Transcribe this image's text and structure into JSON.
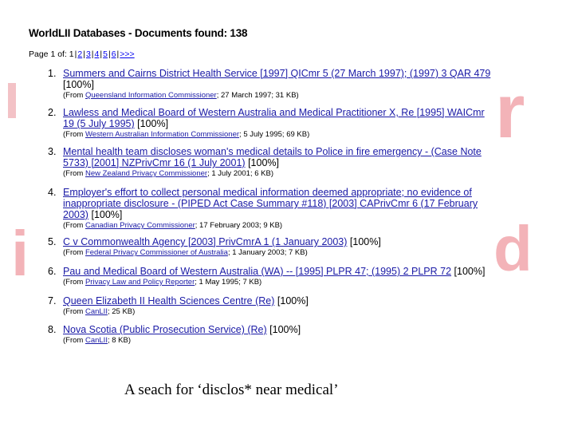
{
  "header": {
    "title": "WorldLII Databases - Documents found: 138"
  },
  "pager": {
    "prefix": "Page 1 of:",
    "current": "1",
    "pages": [
      "2",
      "3",
      "4",
      "5",
      "6"
    ],
    "next": ">>>"
  },
  "results": [
    {
      "num": "1.",
      "title": "Summers and Cairns District Health Service [1997] QICmr 5 (27 March 1997); (1997) 3 QAR 479",
      "score": "[100%]",
      "from_prefix": "(From",
      "source": "Queensland Information Commissioner",
      "from_suffix": "; 27 March 1997; 31 KB)"
    },
    {
      "num": "2.",
      "title": "Lawless and Medical Board of Western Australia and Medical Practitioner X, Re [1995] WAICmr 19 (5 July 1995)",
      "score": "[100%]",
      "from_prefix": "(From",
      "source": "Western Australian Information Commissioner",
      "from_suffix": "; 5 July 1995; 69 KB)"
    },
    {
      "num": "3.",
      "title": "Mental health team discloses woman's medical details to Police in fire emergency - (Case Note 5733) [2001] NZPrivCmr 16 (1 July 2001)",
      "score": "[100%]",
      "from_prefix": "(From",
      "source": "New Zealand Privacy Commissioner",
      "from_suffix": "; 1 July 2001; 6 KB)"
    },
    {
      "num": "4.",
      "title": "Employer's effort to collect personal medical information deemed appropriate; no evidence of inappropriate disclosure - (PIPED Act Case Summary #118) [2003] CAPrivCmr 6 (17 February 2003)",
      "score": "[100%]",
      "from_prefix": "(From",
      "source": "Canadian Privacy Commissioner",
      "from_suffix": "; 17 February 2003; 9 KB)"
    },
    {
      "num": "5.",
      "title": "C v Commonwealth Agency [2003] PrivCmrA 1 (1 January 2003)",
      "score": "[100%]",
      "from_prefix": "(From",
      "source": "Federal Privacy Commissioner of Australia",
      "from_suffix": "; 1 January 2003; 7 KB)"
    },
    {
      "num": "6.",
      "title": "Pau and Medical Board of Western Australia (WA) -- [1995] PLPR 47; (1995) 2 PLPR 72",
      "score": "[100%]",
      "from_prefix": "(From",
      "source": "Privacy Law and Policy Reporter",
      "from_suffix": "; 1 May 1995; 7 KB)"
    },
    {
      "num": "7.",
      "title": "Queen Elizabeth II Health Sciences Centre (Re)",
      "score": "[100%]",
      "from_prefix": "(From",
      "source": "CanLII",
      "from_suffix": "; 25 KB)"
    },
    {
      "num": "8.",
      "title": "Nova Scotia (Public Prosecution Service) (Re)",
      "score": "[100%]",
      "from_prefix": "(From",
      "source": "CanLII",
      "from_suffix": "; 8 KB)"
    }
  ],
  "caption": "A seach for ‘disclos* near medical’",
  "background_letters": [
    "r",
    "i",
    "d"
  ],
  "colors": {
    "link": "#1a1aa6",
    "background_letters": "#f3b3b8"
  }
}
